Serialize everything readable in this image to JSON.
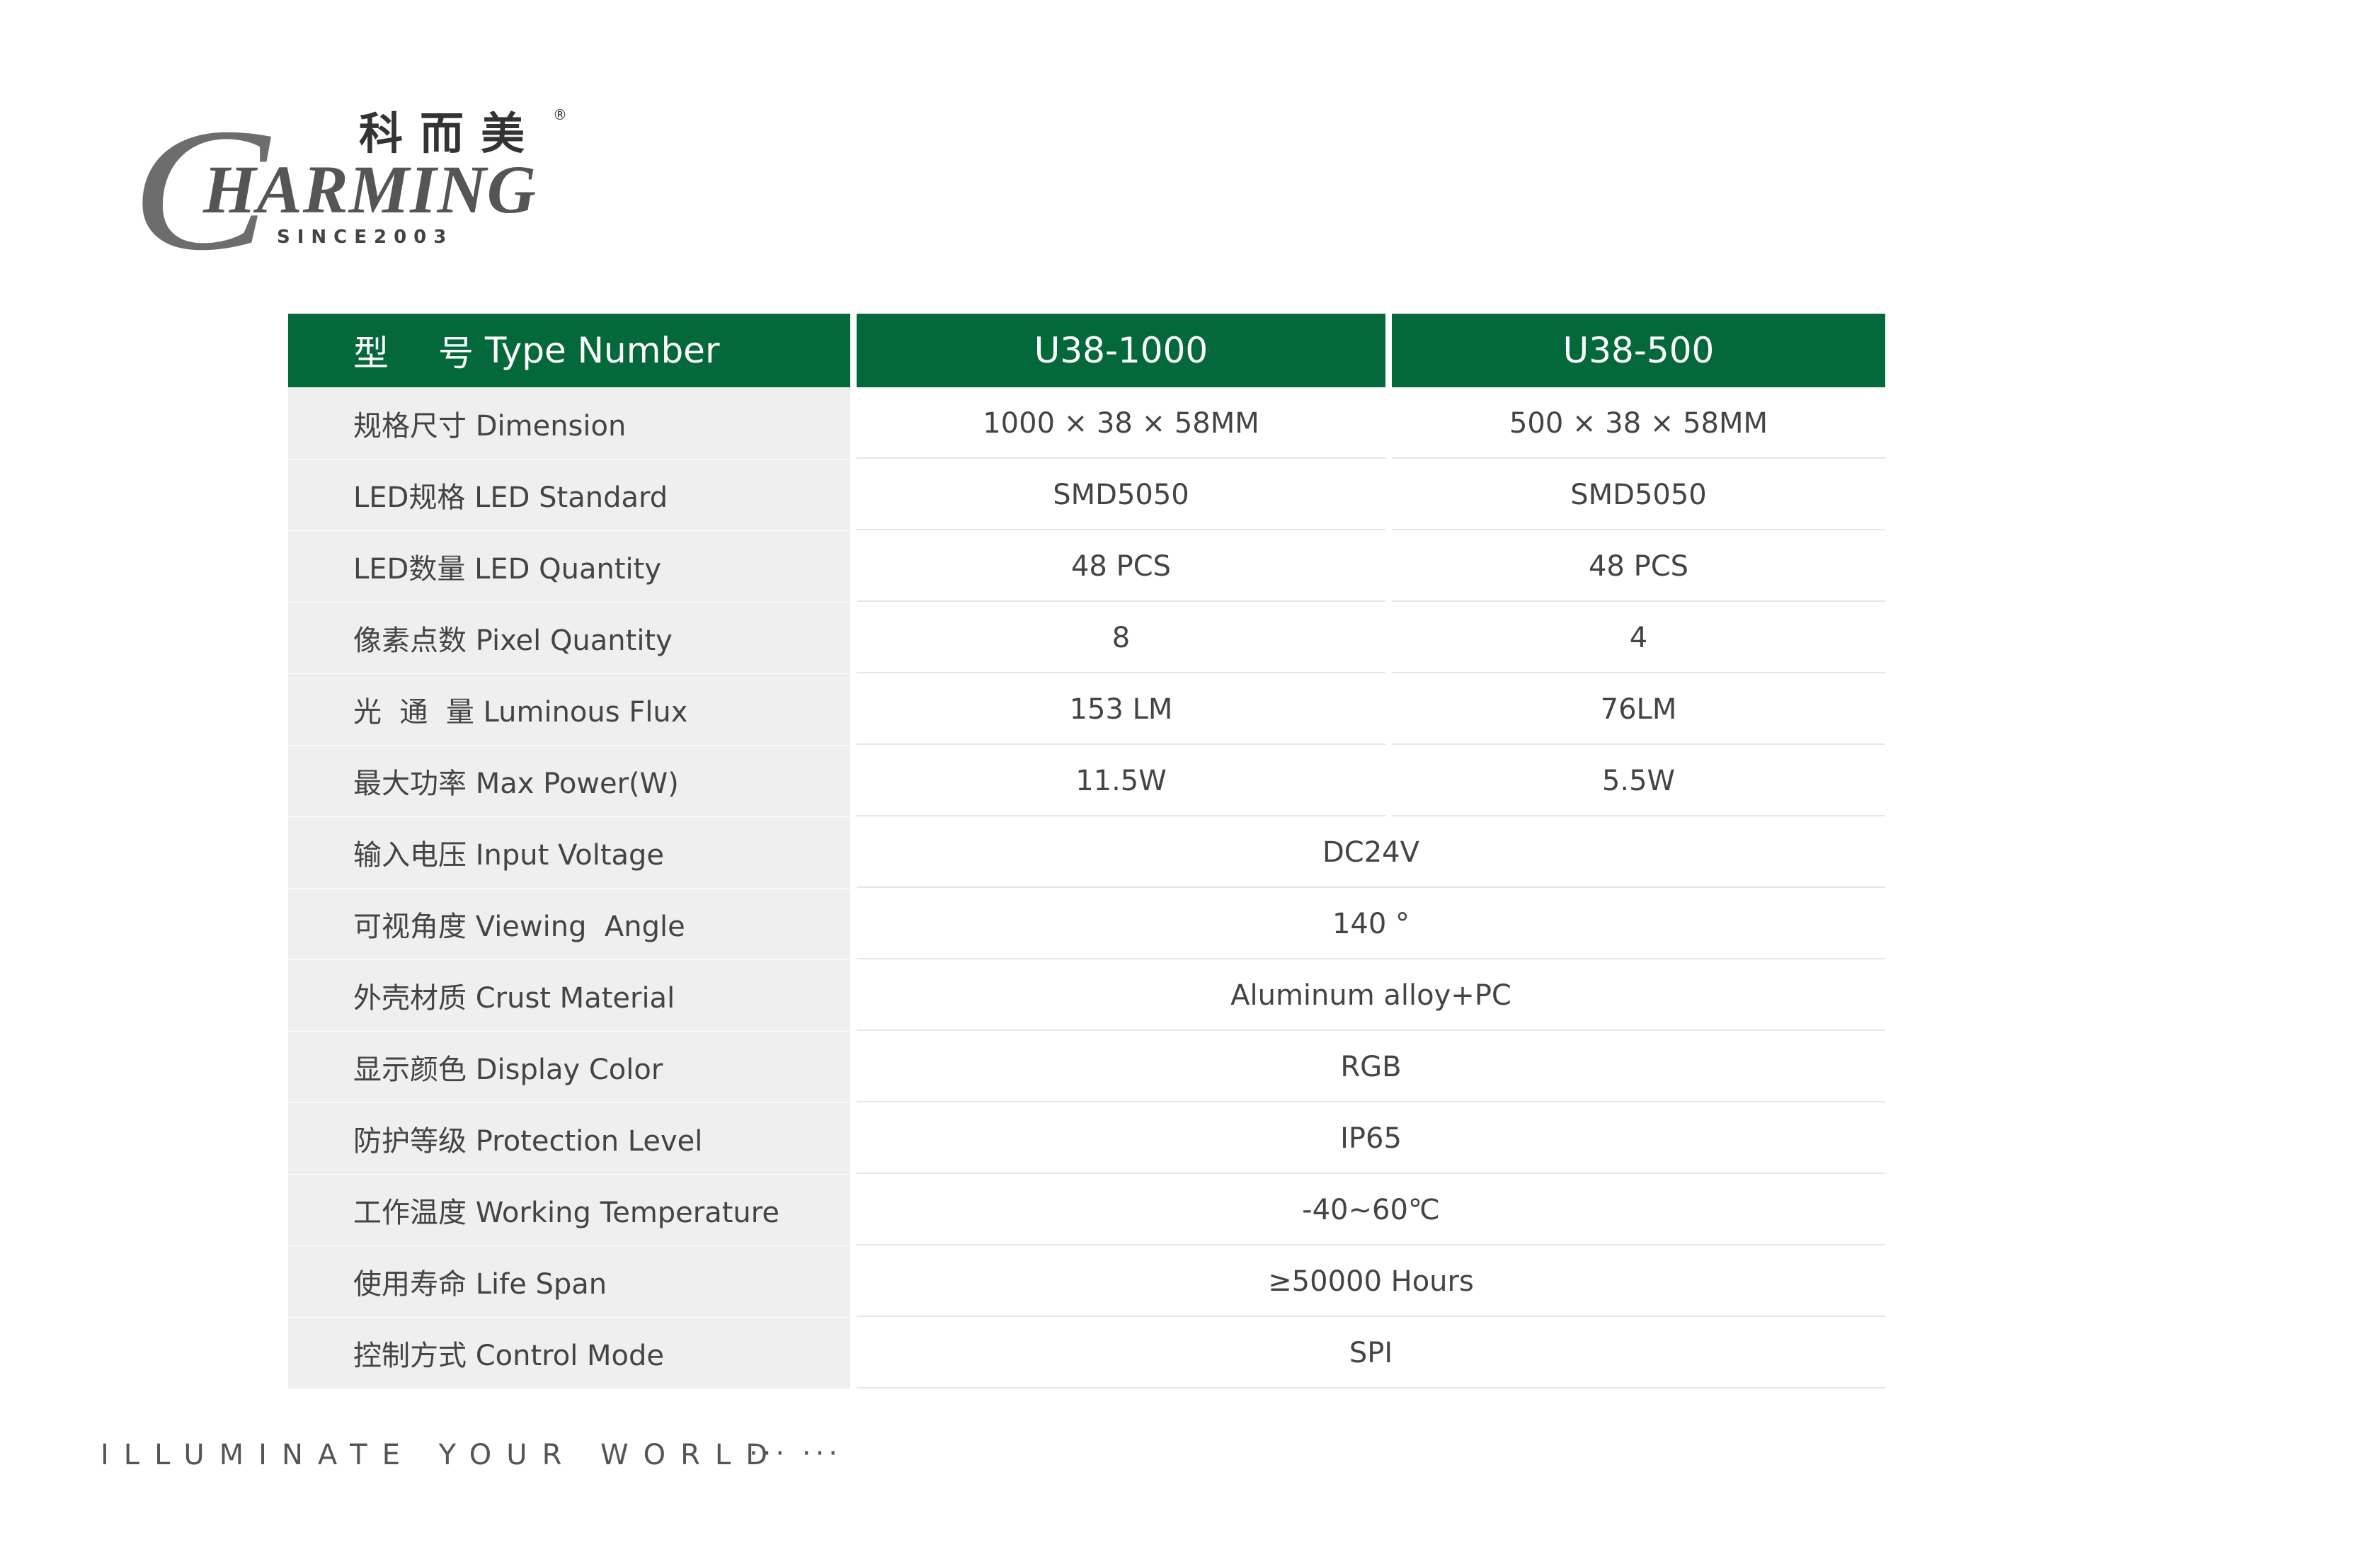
{
  "logo": {
    "initial": "C",
    "word": "HARMING",
    "chinese": "科而美",
    "registered": "®",
    "since": "SINCE2003"
  },
  "table": {
    "header": {
      "label_cn": "型",
      "label_cn2": "号",
      "label_en": "Type Number",
      "models": [
        "U38-1000",
        "U38-500"
      ]
    },
    "rows": [
      {
        "label": "规格尺寸 Dimension",
        "values": [
          "1000 × 38 × 58MM",
          "500 × 38 × 58MM"
        ]
      },
      {
        "label": "LED规格 LED Standard",
        "values": [
          "SMD5050",
          "SMD5050"
        ]
      },
      {
        "label": "LED数量 LED Quantity",
        "values": [
          "48 PCS",
          "48 PCS"
        ]
      },
      {
        "label": "像素点数 Pixel Quantity",
        "values": [
          "8",
          "4"
        ]
      },
      {
        "label": "光  通  量 Luminous Flux",
        "values": [
          "153 LM",
          "76LM"
        ]
      },
      {
        "label": "最大功率 Max Power(W)",
        "values": [
          "11.5W",
          "5.5W"
        ]
      },
      {
        "label": "输入电压 Input Voltage",
        "values": [
          "DC24V"
        ]
      },
      {
        "label": "可视角度 Viewing  Angle",
        "values": [
          "140 °"
        ]
      },
      {
        "label": "外壳材质 Crust Material",
        "values": [
          "Aluminum alloy+PC"
        ]
      },
      {
        "label": "显示颜色 Display Color",
        "values": [
          "RGB"
        ]
      },
      {
        "label": "防护等级 Protection Level",
        "values": [
          "IP65"
        ]
      },
      {
        "label": "工作温度 Working Temperature",
        "values": [
          "-40~60℃"
        ]
      },
      {
        "label": "使用寿命 Life Span",
        "values": [
          "≥50000 Hours"
        ]
      },
      {
        "label": "控制方式 Control Mode",
        "values": [
          "SPI"
        ]
      }
    ]
  },
  "footer": {
    "slogan": "ILLUMINATE YOUR WORLD",
    "dots": "··· ···"
  },
  "colors": {
    "header_bg": "#03683a",
    "label_bg": "#efefef",
    "text": "#444444"
  }
}
